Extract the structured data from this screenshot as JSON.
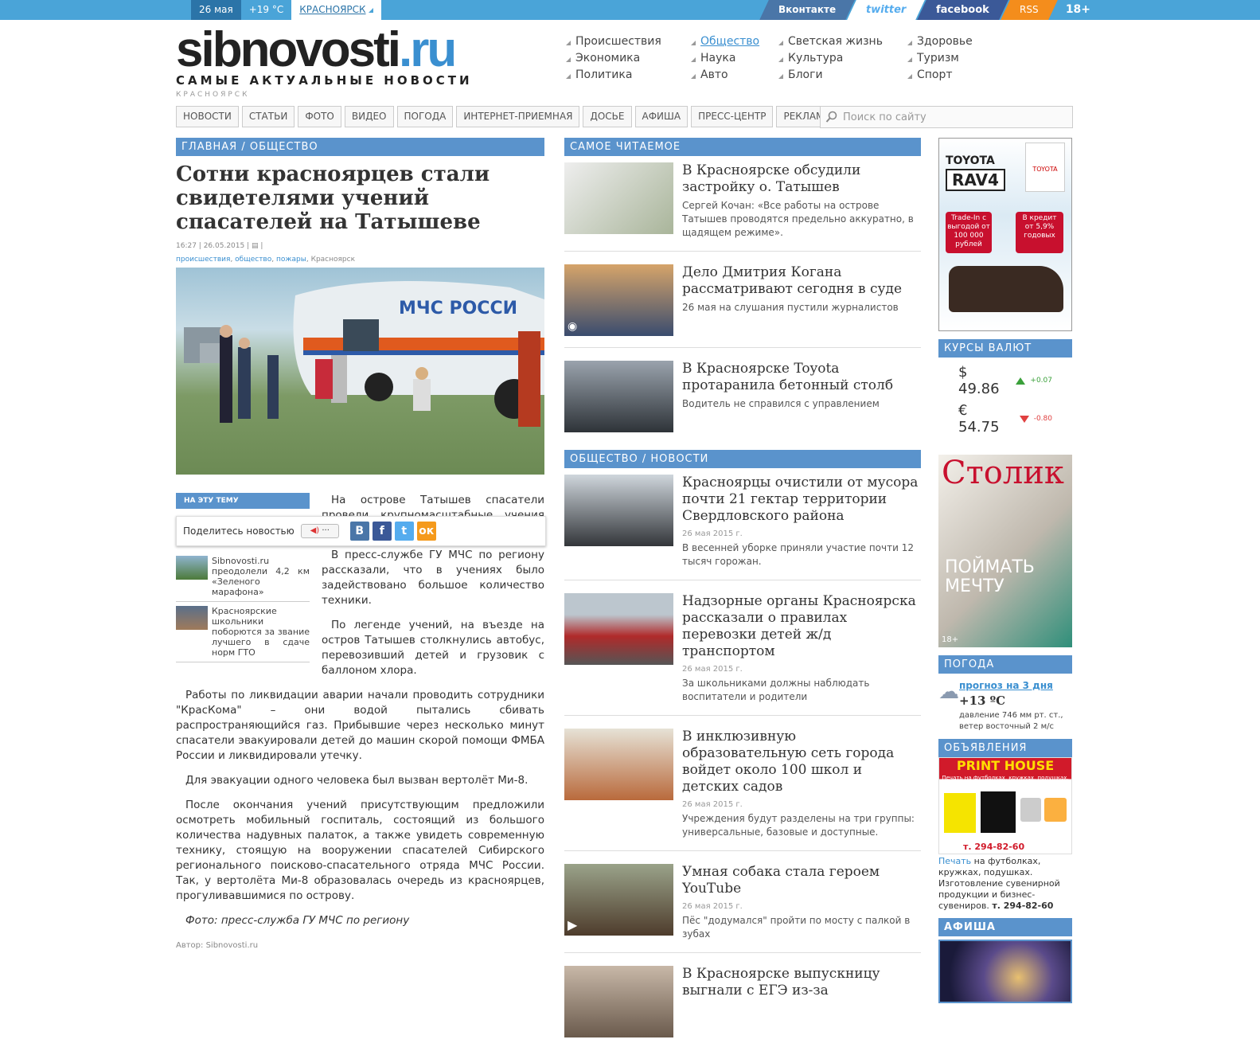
{
  "topbar": {
    "date": "26 мая",
    "temp": "+19 °С",
    "city": "КРАСНОЯРСК",
    "vk": "Вконтакте",
    "twitter": "twitter",
    "facebook": "facebook",
    "rss": "RSS",
    "age": "18+"
  },
  "logo": {
    "main": "sibnovosti",
    "tld": ".ru",
    "slogan": "САМЫЕ АКТУАЛЬНЫЕ НОВОСТИ",
    "city": "КРАСНОЯРСК"
  },
  "categories": [
    "Происшествия",
    "Общество",
    "Светская жизнь",
    "Здоровье",
    "Экономика",
    "Наука",
    "Культура",
    "Туризм",
    "Политика",
    "Авто",
    "Блоги",
    "Спорт"
  ],
  "nav": [
    "НОВОСТИ",
    "СТАТЬИ",
    "ФОТО",
    "ВИДЕО",
    "ПОГОДА",
    "ИНТЕРНЕТ-ПРИЕМНАЯ",
    "ДОСЬЕ",
    "АФИША",
    "ПРЕСС-ЦЕНТР",
    "РЕКЛАМА"
  ],
  "search": {
    "placeholder": "Поиск по сайту"
  },
  "article": {
    "breadcrumb": "ГЛАВНАЯ / ОБЩЕСТВО",
    "title": "Сотни красноярцев стали свидетелями учений спасателей на Татышеве",
    "time": "16:27",
    "date": "26.05.2015",
    "tags": [
      "происшествия",
      "общество",
      "пожары"
    ],
    "tag_city": "Красноярск",
    "p1": "На острове Татышев спасатели провели крупномасштабные учения красноярцев.",
    "p2": "В пресс-службе ГУ МЧС по региону рассказали, что в учениях было задействовано большое количество техники.",
    "p3": "По легенде учений, на въезде на остров Татышев столкнулись автобус, перевозивший детей и грузовик с баллоном хлора.",
    "p4": "Работы по ликвидации аварии начали проводить сотрудники \"КрасКома\" – они водой пытались сбивать распространяющийся газ. Прибывшие через несколько минут спасатели эвакуировали детей до машин скорой помощи ФМБА России и ликвидировали утечку.",
    "p5": "Для эвакуации одного человека был вызван вертолёт Ми-8.",
    "p6": "После окончания учений присутствующим предложили осмотреть мобильный госпиталь, состоящий из большого количества надувных палаток, а также увидеть современную технику, стоящую на вооружении спасателей Сибирского регионального поисково-спасательного отряда МЧС России. Так, у вертолёта Ми-8 образовалась очередь из красноярцев, прогуливавшимися по острову.",
    "caption": "Фото: пресс-служба ГУ МЧС по региону",
    "author": "Автор: Sibnovosti.ru",
    "heli_text": "МЧС РОССИ"
  },
  "related": {
    "title": "НА ЭТУ ТЕМУ",
    "items": [
      "Sibnovosti.ru преодолели 4,2 км «Зеленого марафона»",
      "Красноярские школьники поборются за звание лучшего в сдаче норм ГТО"
    ]
  },
  "share": {
    "label": "Поделитесь новостью"
  },
  "popular": {
    "title": "САМОЕ ЧИТАЕМОЕ",
    "items": [
      {
        "title": "В Красноярске обсудили застройку о. Татышев",
        "desc": "Сергей Кочан: «Все работы на острове Татышев проводятся предельно аккуратно, в щадящем режиме»."
      },
      {
        "title": "Дело Дмитрия Когана рассматривают сегодня в суде",
        "desc": "26 мая на слушания пустили журналистов"
      },
      {
        "title": "В Красноярске Toyota протаранила бетонный столб",
        "desc": "Водитель не справился с управлением"
      }
    ]
  },
  "society": {
    "title": "ОБЩЕСТВО / НОВОСТИ",
    "items": [
      {
        "title": "Красноярцы очистили от мусора почти 21 гектар территории Свердловского района",
        "date": "26 мая 2015 г.",
        "desc": "В весенней уборке приняли участие почти 12 тысяч горожан."
      },
      {
        "title": "Надзорные органы Красноярска рассказали о правилах перевозки детей ж/д транспортом",
        "date": "26 мая 2015 г.",
        "desc": "За школьниками должны наблюдать воспитатели и родители"
      },
      {
        "title": "В инклюзивную образовательную сеть города войдет около 100 школ и детских садов",
        "date": "26 мая 2015 г.",
        "desc": "Учреждения будут разделены на три группы: универсальные, базовые и доступные."
      },
      {
        "title": "Умная собака стала героем YouTube",
        "date": "26 мая 2015 г.",
        "desc": "Пёс \"додумался\" пройти по мосту с палкой в зубах"
      },
      {
        "title": "В Красноярске выпускницу выгнали с ЕГЭ из-за",
        "date": "",
        "desc": ""
      }
    ]
  },
  "ad": {
    "brand": "TOYOTA",
    "model": "RAV4",
    "tradein": "Trade-In с выгодой от 100 000 рублей",
    "credit": "В кредит от 5,9% годовых",
    "brand_small": "TOYOTA"
  },
  "currency": {
    "title": "КУРСЫ ВАЛЮТ",
    "usd": "$ 49.86",
    "usd_delta": "+0.07",
    "eur": "€ 54.75",
    "eur_delta": "-0.80"
  },
  "magazine": {
    "name": "Столик",
    "cover": "ПОЙМАТЬ МЕЧТУ",
    "age": "18+"
  },
  "weather": {
    "title": "ПОГОДА",
    "link": "прогноз на 3 дня",
    "temp": "+13 ºС",
    "details": "давление 746 мм рт. ст., ветер восточный 2 м/с"
  },
  "classifieds": {
    "title": "ОБЪЯВЛЕНИЯ",
    "banner": "PRINT HOUSE",
    "banner_sub": "Печать на футболках, кружках, подушках.",
    "phone": "т. 294-82-60",
    "link": "Печать",
    "text": " на футболках, кружках, подушках. Изготовление сувенирной продукции и бизнес-сувениров.",
    "phone2": "т. 294-82-60"
  },
  "afisha": {
    "title": "АФИША"
  }
}
